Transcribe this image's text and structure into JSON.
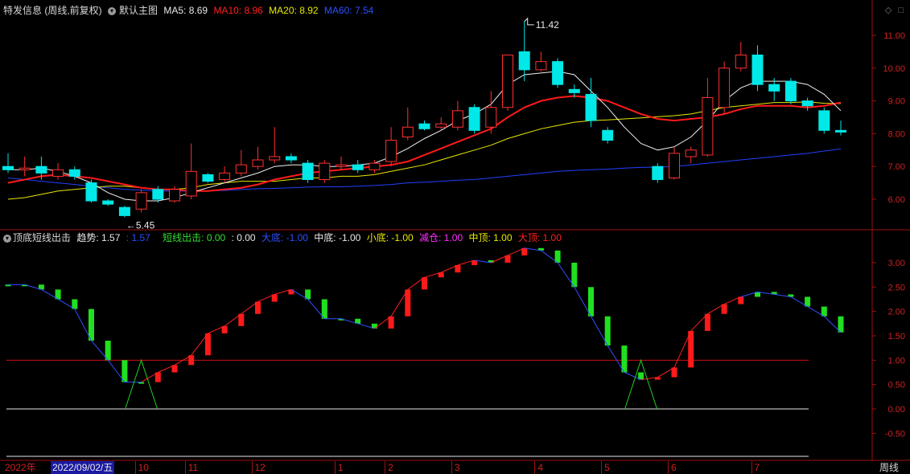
{
  "main_header": {
    "title": "特发信息 (周线,前复权)",
    "icon": "circle-chevron-icon",
    "template": "默认主图",
    "ma5_label": "MA5:",
    "ma5_value": "8.69",
    "ma10_label": "MA10:",
    "ma10_value": "8.96",
    "ma20_label": "MA20:",
    "ma20_value": "8.92",
    "ma60_label": "MA60:",
    "ma60_value": "7.54",
    "colors": {
      "ma5": "#e8e8e8",
      "ma10": "#ff2020",
      "ma20": "#e8e800",
      "ma60": "#2040ff"
    }
  },
  "indicator_header": {
    "title": "顶底短线出击",
    "trend_label": "趋势:",
    "trend_value": "1.57",
    "trend_sep": ":",
    "trend_value2": "1.57",
    "short_label": "短线出击:",
    "short_value": "0.00",
    "short_value2": ": 0.00",
    "bigbottom_label": "大底:",
    "bigbottom_value": "-1.00",
    "midbottom_label": "中底:",
    "midbottom_value": "-1.00",
    "smallbottom_label": "小底:",
    "smallbottom_value": "-1.00",
    "reduce_label": "减仓:",
    "reduce_value": "1.00",
    "midtop_label": "中顶:",
    "midtop_value": "1.00",
    "bigtop_label": "大顶:",
    "bigtop_value": "1.00"
  },
  "price_axis": [
    "11.00",
    "10.00",
    "9.00",
    "8.00",
    "7.00",
    "6.00"
  ],
  "ind_axis": [
    "3.00",
    "2.50",
    "2.00",
    "1.50",
    "1.00",
    "0.50",
    "0.00",
    "-0.50"
  ],
  "annotations": {
    "high": "11.42",
    "low": "5.45"
  },
  "bottom_bar": {
    "year": "2022年",
    "selected_date": "2022/09/02/五",
    "months": [
      "10",
      "11",
      "12",
      "1",
      "2",
      "3",
      "4",
      "5",
      "6",
      "7"
    ],
    "period": "周线"
  },
  "chart_data": [
    {
      "type": "candlestick",
      "title": "特发信息 (周线,前复权)",
      "candles": [
        [
          7.0,
          6.9,
          7.4,
          6.8
        ],
        [
          6.9,
          6.95,
          7.3,
          6.7
        ],
        [
          7.0,
          6.8,
          7.3,
          6.6
        ],
        [
          6.7,
          6.9,
          7.1,
          6.6
        ],
        [
          6.9,
          6.7,
          7.0,
          6.6
        ],
        [
          6.5,
          5.95,
          6.6,
          5.9
        ],
        [
          5.95,
          5.85,
          6.0,
          5.8
        ],
        [
          5.75,
          5.5,
          5.8,
          5.45
        ],
        [
          5.7,
          6.2,
          6.3,
          5.6
        ],
        [
          6.3,
          6.0,
          6.4,
          5.9
        ],
        [
          5.95,
          6.3,
          6.4,
          5.9
        ],
        [
          6.1,
          6.85,
          7.7,
          6.0
        ],
        [
          6.75,
          6.55,
          6.8,
          6.5
        ],
        [
          6.6,
          6.8,
          7.0,
          6.5
        ],
        [
          6.8,
          7.05,
          7.5,
          6.7
        ],
        [
          7.0,
          7.2,
          7.6,
          6.9
        ],
        [
          7.2,
          7.3,
          8.2,
          7.1
        ],
        [
          7.3,
          7.2,
          7.4,
          7.1
        ],
        [
          7.1,
          6.6,
          7.2,
          6.5
        ],
        [
          6.6,
          7.1,
          7.2,
          6.5
        ],
        [
          7.0,
          7.05,
          7.3,
          6.9
        ],
        [
          7.05,
          6.9,
          7.2,
          6.8
        ],
        [
          6.9,
          7.1,
          7.2,
          6.8
        ],
        [
          7.15,
          7.8,
          8.2,
          7.0
        ],
        [
          7.9,
          8.2,
          8.8,
          7.8
        ],
        [
          8.3,
          8.15,
          8.4,
          8.1
        ],
        [
          8.2,
          8.3,
          8.5,
          8.1
        ],
        [
          8.2,
          8.7,
          9.0,
          8.1
        ],
        [
          8.8,
          8.1,
          8.9,
          8.0
        ],
        [
          8.2,
          8.8,
          9.3,
          8.0
        ],
        [
          8.8,
          10.4,
          10.4,
          8.7
        ],
        [
          10.5,
          9.95,
          11.42,
          9.6
        ],
        [
          9.95,
          10.2,
          10.5,
          9.9
        ],
        [
          10.2,
          9.5,
          10.3,
          9.4
        ],
        [
          9.35,
          9.25,
          9.5,
          9.1
        ],
        [
          9.2,
          8.4,
          9.7,
          8.2
        ],
        [
          8.1,
          7.8,
          8.2,
          7.7
        ],
        [
          null,
          null,
          null,
          null
        ],
        [
          null,
          null,
          null,
          null
        ],
        [
          7.0,
          6.6,
          7.1,
          6.5
        ],
        [
          6.65,
          7.4,
          7.6,
          6.6
        ],
        [
          7.3,
          7.5,
          7.6,
          7.1
        ],
        [
          7.35,
          9.1,
          9.7,
          7.3
        ],
        [
          8.8,
          10.0,
          10.2,
          8.6
        ],
        [
          10.0,
          10.4,
          10.8,
          9.9
        ],
        [
          10.4,
          9.5,
          10.7,
          9.3
        ],
        [
          9.5,
          9.3,
          9.7,
          9.0
        ],
        [
          9.6,
          9.0,
          9.7,
          8.9
        ],
        [
          9.0,
          8.85,
          9.1,
          8.7
        ],
        [
          8.7,
          8.1,
          8.8,
          8.0
        ],
        [
          8.1,
          8.05,
          8.4,
          7.95
        ]
      ],
      "ma5": [
        6.9,
        6.9,
        6.95,
        6.85,
        6.7,
        6.5,
        6.2,
        6.0,
        5.95,
        5.95,
        6.05,
        6.2,
        6.35,
        6.5,
        6.65,
        6.8,
        7.0,
        7.05,
        7.05,
        7.0,
        7.0,
        7.05,
        7.1,
        7.3,
        7.55,
        7.85,
        8.1,
        8.4,
        8.6,
        8.9,
        9.5,
        9.8,
        9.85,
        9.9,
        9.8,
        9.3,
        8.8,
        8.2,
        7.7,
        7.5,
        7.6,
        7.9,
        8.4,
        9.0,
        9.4,
        9.6,
        9.6,
        9.6,
        9.5,
        9.2,
        8.7
      ],
      "ma10": [
        6.5,
        6.6,
        6.7,
        6.75,
        6.7,
        6.65,
        6.55,
        6.45,
        6.35,
        6.3,
        6.3,
        6.25,
        6.25,
        6.3,
        6.35,
        6.45,
        6.6,
        6.7,
        6.8,
        6.85,
        6.9,
        6.95,
        7.0,
        7.05,
        7.15,
        7.35,
        7.55,
        7.75,
        7.95,
        8.15,
        8.5,
        8.8,
        9.0,
        9.1,
        9.15,
        9.1,
        9.0,
        8.8,
        8.6,
        8.45,
        8.4,
        8.45,
        8.5,
        8.6,
        8.75,
        8.85,
        8.85,
        8.85,
        8.8,
        8.85,
        8.95
      ],
      "ma20": [
        6.0,
        6.05,
        6.15,
        6.25,
        6.3,
        6.35,
        6.4,
        6.4,
        6.35,
        6.3,
        6.3,
        6.35,
        6.45,
        6.5,
        6.55,
        6.55,
        6.55,
        6.6,
        6.65,
        6.65,
        6.7,
        6.7,
        6.75,
        6.85,
        6.95,
        7.05,
        7.2,
        7.35,
        7.5,
        7.65,
        7.85,
        8.0,
        8.15,
        8.25,
        8.35,
        8.4,
        8.42,
        8.45,
        8.48,
        8.52,
        8.55,
        8.6,
        8.7,
        8.8,
        8.85,
        8.9,
        8.95,
        8.95,
        8.97,
        8.93,
        8.92
      ],
      "ma60": [
        6.65,
        6.6,
        6.55,
        6.5,
        6.45,
        6.4,
        6.35,
        6.3,
        6.28,
        6.25,
        6.25,
        6.25,
        6.25,
        6.27,
        6.3,
        6.32,
        6.33,
        6.35,
        6.37,
        6.38,
        6.38,
        6.4,
        6.42,
        6.45,
        6.5,
        6.52,
        6.55,
        6.58,
        6.6,
        6.65,
        6.7,
        6.75,
        6.8,
        6.85,
        6.88,
        6.9,
        6.92,
        6.95,
        6.97,
        6.98,
        7.0,
        7.05,
        7.1,
        7.15,
        7.2,
        7.25,
        7.3,
        7.35,
        7.4,
        7.47,
        7.54
      ],
      "ylim": [
        5.1,
        11.9
      ]
    },
    {
      "type": "line",
      "title": "顶底短线出击",
      "trend": [
        2.55,
        2.55,
        2.45,
        2.25,
        2.05,
        1.4,
        1.0,
        0.55,
        0.55,
        0.75,
        0.9,
        1.1,
        1.55,
        1.7,
        1.95,
        2.2,
        2.35,
        2.45,
        2.25,
        1.85,
        1.85,
        1.75,
        1.65,
        1.9,
        2.45,
        2.7,
        2.8,
        2.95,
        3.05,
        3.0,
        3.15,
        3.3,
        3.25,
        3.0,
        2.5,
        1.9,
        1.3,
        0.75,
        0.6,
        0.65,
        0.85,
        1.6,
        1.95,
        2.15,
        2.3,
        2.4,
        2.35,
        2.3,
        2.1,
        1.9,
        1.57
      ],
      "trend_up": [
        0,
        0,
        0,
        0,
        0,
        0,
        0,
        0,
        0,
        1,
        1,
        1,
        1,
        1,
        1,
        1,
        1,
        1,
        0,
        0,
        0,
        0,
        0,
        1,
        1,
        1,
        1,
        1,
        1,
        0,
        1,
        1,
        0,
        0,
        0,
        0,
        0,
        0,
        0,
        1,
        1,
        1,
        1,
        1,
        1,
        0,
        0,
        0,
        0,
        0,
        0
      ],
      "bottom_signals": [
        8,
        38
      ],
      "reference_lines": [
        1.0,
        0.0
      ],
      "ylim": [
        -0.95,
        3.55
      ]
    }
  ]
}
